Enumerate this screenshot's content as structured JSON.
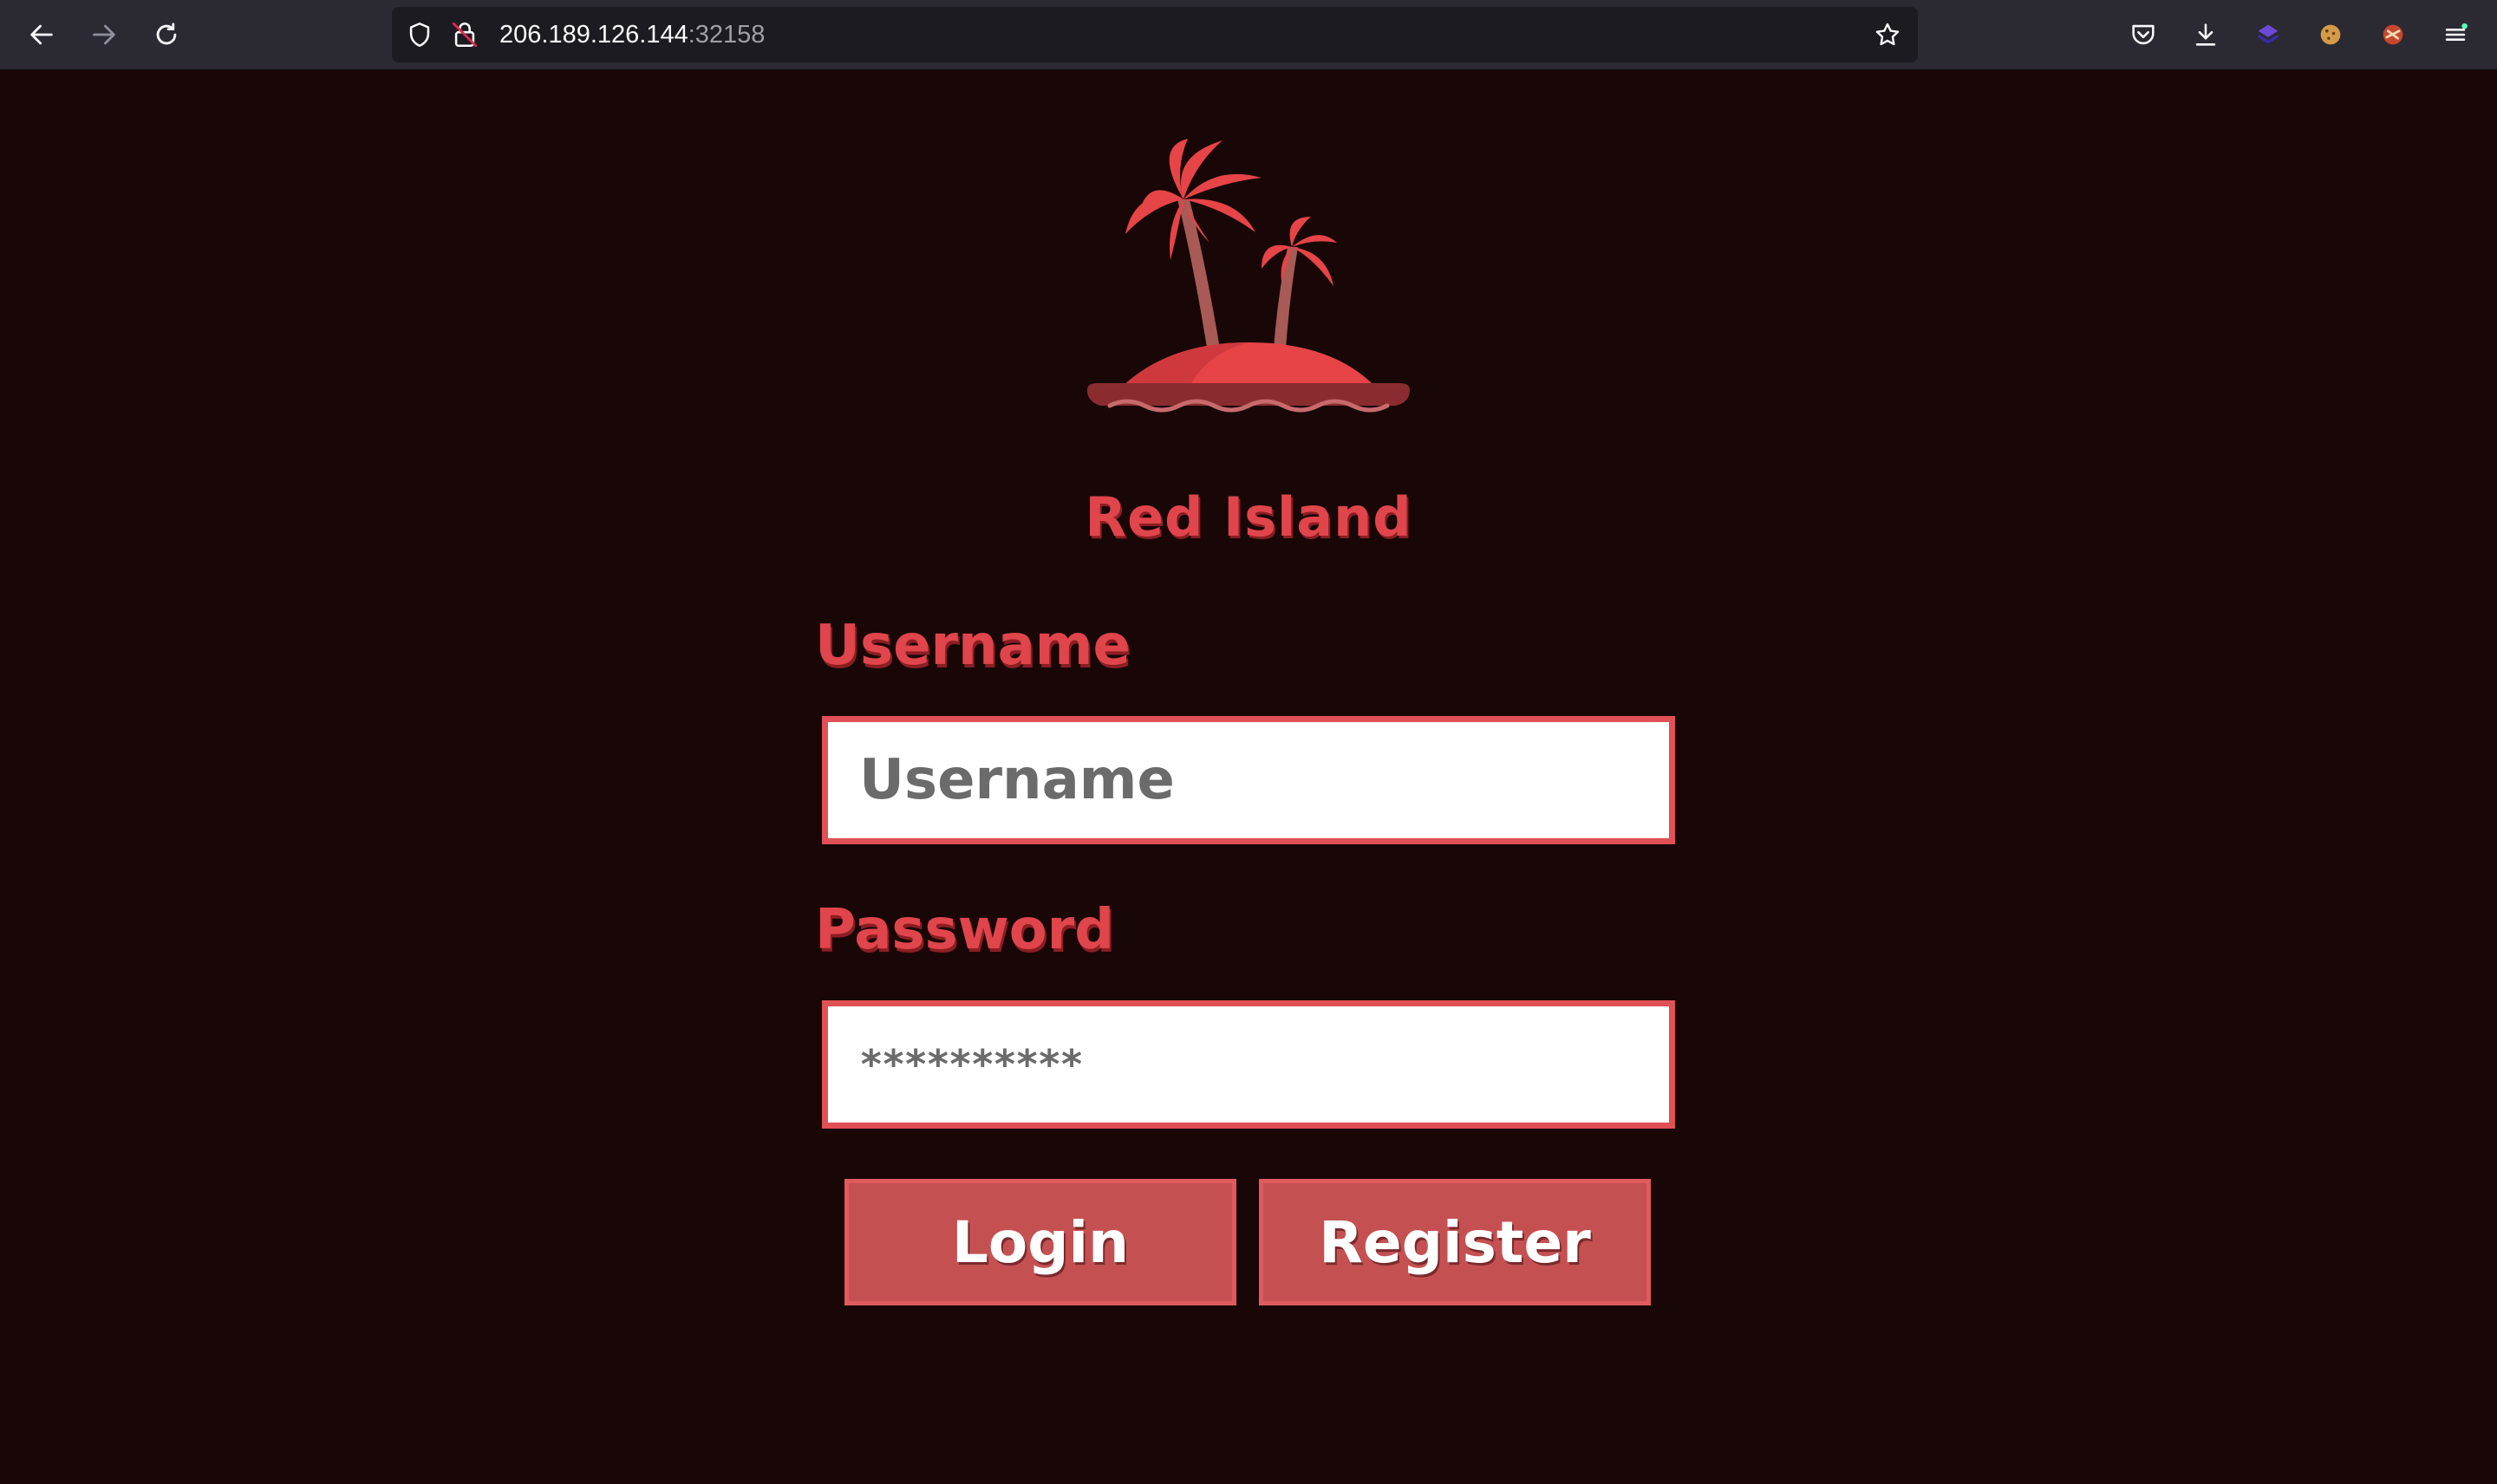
{
  "browser": {
    "url_host": "206.189.126.144",
    "url_port": ":32158",
    "icons": {
      "back": "arrow-left-icon",
      "forward": "arrow-right-icon",
      "reload": "reload-icon",
      "tracking_protection": "shield-icon",
      "connection": "insecure-lock-icon",
      "bookmark": "star-icon",
      "pocket": "pocket-icon",
      "downloads": "download-icon",
      "extension_1": "cube-extension-icon",
      "extension_2": "cookie-icon",
      "extension_3": "extension-badge-icon",
      "menu": "hamburger-menu-icon"
    }
  },
  "page": {
    "brand_title": "Red Island",
    "username_label": "Username",
    "username_placeholder": "Username",
    "password_label": "Password",
    "password_value": "**********",
    "login_button": "Login",
    "register_button": "Register"
  },
  "colors": {
    "background": "#190708",
    "accent_red": "#e0454b",
    "button_fill": "#c55052",
    "input_border": "#e05055",
    "toolbar": "#2b2a33"
  }
}
